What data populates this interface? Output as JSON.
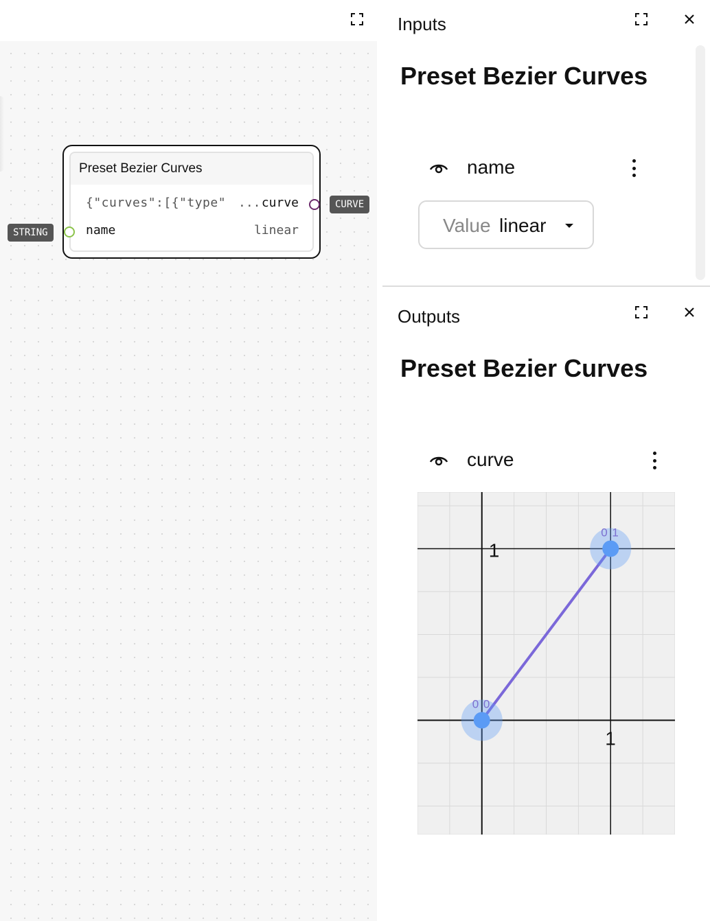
{
  "canvas": {
    "node": {
      "title": "Preset Bezier Curves",
      "output_preview": "{\"curves\":[{\"type\"",
      "output_ellipsis": "...",
      "output_label": "curve",
      "input_label": "name",
      "input_value": "linear"
    },
    "badges": {
      "output_type": "CURVE",
      "input_type": "STRING"
    },
    "port_colors": {
      "curve": "#6b2a6b",
      "string": "#8bc34a"
    }
  },
  "inputs_panel": {
    "header": "Inputs",
    "heading": "Preset Bezier Curves",
    "param": {
      "label": "name",
      "value_label": "Value",
      "value": "linear"
    }
  },
  "outputs_panel": {
    "header": "Outputs",
    "heading": "Preset Bezier Curves",
    "param": {
      "label": "curve"
    }
  },
  "chart_data": {
    "type": "line",
    "x_ticks": [
      "1"
    ],
    "y_ticks": [
      "1"
    ],
    "xlim": [
      -0.5,
      1.5
    ],
    "ylim": [
      -0.666,
      1.33
    ],
    "grid": true,
    "series": [
      {
        "x": [
          0,
          1
        ],
        "y": [
          0,
          1
        ],
        "color": "#7b68d9"
      }
    ],
    "control_points": [
      {
        "x": 0,
        "y": 0,
        "label": "0 0"
      },
      {
        "x": 1,
        "y": 1,
        "label": "0 1"
      }
    ],
    "point_color": "#5b9bf5"
  },
  "icons": {
    "fullscreen": "fullscreen-icon",
    "close": "close-icon",
    "visibility": "eye-icon",
    "more": "more-vertical-icon"
  }
}
